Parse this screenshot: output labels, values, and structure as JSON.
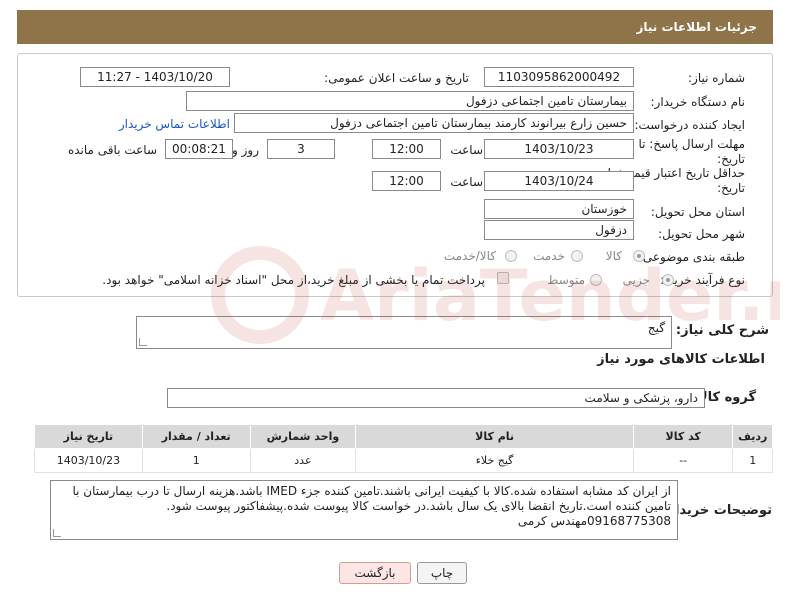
{
  "header": {
    "title": "جزئیات اطلاعات نیاز"
  },
  "fields": {
    "need_number_label": "شماره نیاز:",
    "need_number": "1103095862000492",
    "announce_label": "تاریخ و ساعت اعلان عمومی:",
    "announce_value": "1403/10/20 - 11:27",
    "buyer_org_label": "نام دستگاه خریدار:",
    "buyer_org": "بیمارستان تامین اجتماعی دزفول",
    "creator_label": "ایجاد کننده درخواست:",
    "creator": "حسین زارع بیرانوند کارمند بیمارستان تامین اجتماعی دزفول",
    "contact_link": "اطلاعات تماس خریدار",
    "reply_deadline_label": "مهلت ارسال پاسخ: تا تاریخ:",
    "reply_date": "1403/10/23",
    "time_label": "ساعت",
    "reply_time": "12:00",
    "days_value": "3",
    "days_label": "روز و",
    "remaining_time": "00:08:21",
    "remaining_label": "ساعت باقی مانده",
    "price_validity_label": "حداقل تاریخ اعتبار قیمت: تا تاریخ:",
    "price_date": "1403/10/24",
    "price_time": "12:00",
    "province_label": "استان محل تحویل:",
    "province": "خوزستان",
    "city_label": "شهر محل تحویل:",
    "city": "دزفول",
    "category_label": "طبقه بندی موضوعی:",
    "category_options": [
      "کالا",
      "خدمت",
      "کالا/خدمت"
    ],
    "process_label": "نوع فرآیند خرید :",
    "process_options": [
      "جزیی",
      "متوسط"
    ],
    "payment_note": "پرداخت تمام یا بخشی از مبلغ خرید،از محل \"اسناد خزانه اسلامی\" خواهد بود."
  },
  "summary": {
    "label": "شرح کلی نیاز:",
    "value": "گیج"
  },
  "goods": {
    "section_title": "اطلاعات کالاهای مورد نیاز",
    "group_label": "گروه کالا:",
    "group_value": "دارو، پزشکی و سلامت",
    "columns": [
      "ردیف",
      "کد کالا",
      "نام کالا",
      "واحد شمارش",
      "تعداد / مقدار",
      "تاریخ نیاز"
    ],
    "rows": [
      [
        "1",
        "--",
        "گیج خلاء",
        "عدد",
        "1",
        "1403/10/23"
      ]
    ]
  },
  "buyer_notes": {
    "label": "توضیحات خریدار:",
    "lines": [
      "از ایران کد مشابه استفاده شده.کالا با کیفیت ایرانی باشند.تامین کننده جزء IMED باشد.هزینه ارسال تا درب بیمارستان با",
      "تامین کننده است.تاریخ انقضا بالای یک سال باشد.در خواست کالا پیوست شده.پیشفاکتور پیوست شود.",
      "09168775308مهندس کرمی"
    ]
  },
  "buttons": {
    "print": "چاپ",
    "back": "بازگشت"
  },
  "watermark": {
    "text": "AriaTender.net"
  },
  "colors": {
    "header_bg": "#8f7449",
    "link": "#1a55c4",
    "watermark": "#c0392b"
  }
}
